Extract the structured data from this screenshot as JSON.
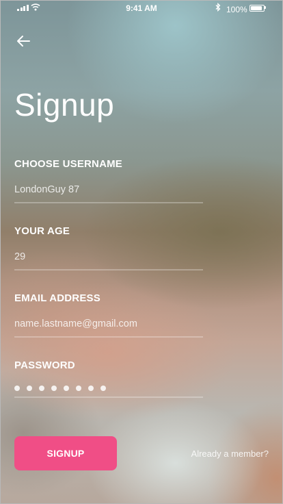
{
  "status_bar": {
    "time": "9:41 AM",
    "battery_percent": "100%",
    "battery_level": 1.0,
    "icons": [
      "signal-icon",
      "wifi-icon",
      "bluetooth-icon",
      "battery-icon"
    ]
  },
  "header": {
    "back_icon": "arrow-left-icon",
    "title": "Signup"
  },
  "form": {
    "username": {
      "label": "CHOOSE USERNAME",
      "value": "LondonGuy 87"
    },
    "age": {
      "label": "YOUR AGE",
      "value": "29"
    },
    "email": {
      "label": "EMAIL ADDRESS",
      "value": "name.lastname@gmail.com"
    },
    "password": {
      "label": "PASSWORD",
      "masked_length": 8
    }
  },
  "actions": {
    "signup_label": "SIGNUP",
    "member_link": "Already a member?"
  },
  "colors": {
    "accent": "#f04e86",
    "text": "#ffffff"
  }
}
